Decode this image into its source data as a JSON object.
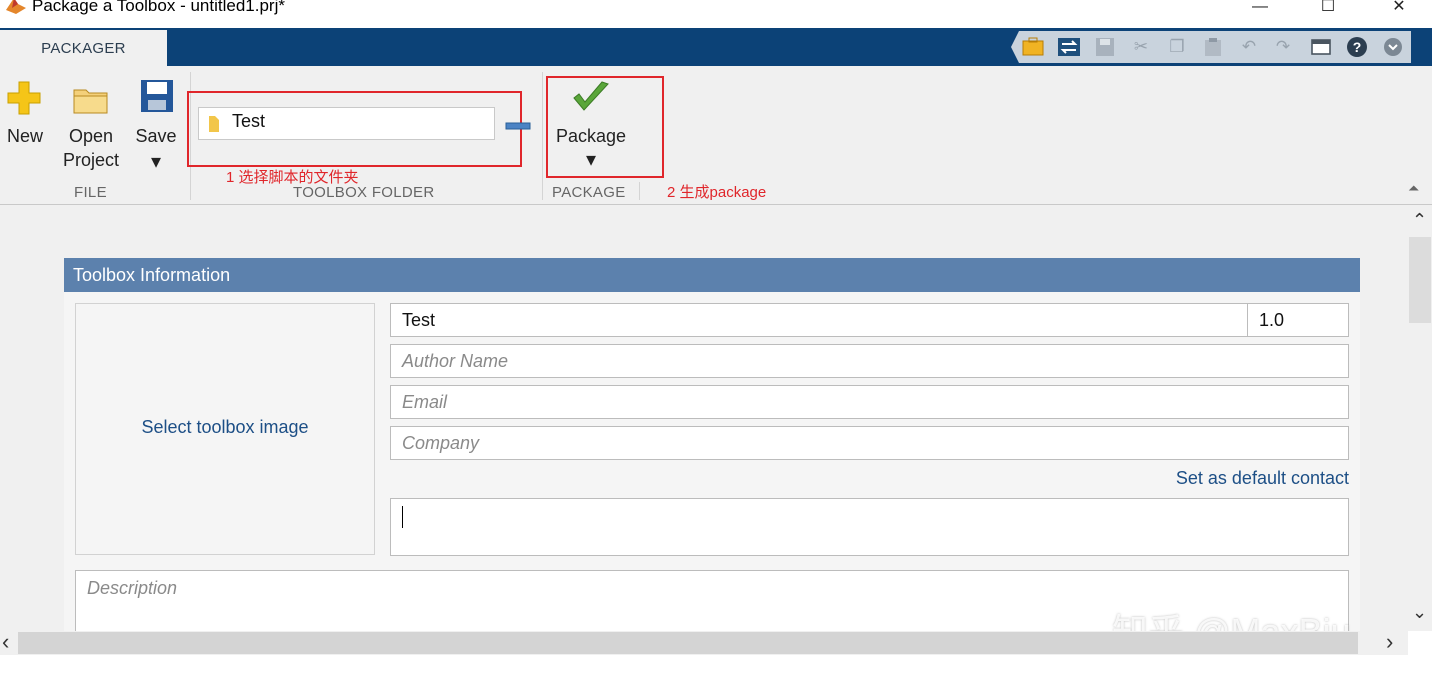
{
  "window": {
    "title": "Package a Toolbox - untitled1.prj*",
    "minimize_glyph": "—",
    "maximize_glyph": "☐",
    "close_glyph": "✕"
  },
  "tabs": [
    {
      "label": "PACKAGER",
      "active": true
    }
  ],
  "quick_access": {
    "icons": [
      "toolbox-icon",
      "toggle-layout-icon",
      "save-icon",
      "cut-icon",
      "copy-icon",
      "paste-icon",
      "undo-icon",
      "redo-icon",
      "window-icon",
      "help-icon",
      "expand-icon"
    ]
  },
  "ribbon": {
    "file": {
      "section_label": "FILE",
      "new_label": "New",
      "open_label_1": "Open",
      "open_label_2": "Project",
      "save_label": "Save",
      "dropdown_glyph": "▾"
    },
    "toolbox_folder": {
      "section_label": "TOOLBOX FOLDER",
      "folder_value": "Test"
    },
    "package": {
      "section_label": "PACKAGE",
      "button_label": "Package",
      "dropdown_glyph": "▾"
    },
    "collapse_glyph": "⏶"
  },
  "annotations": {
    "step1": "1  选择脚本的文件夹",
    "step2": "2 生成package",
    "accent_color": "#e0262b"
  },
  "toolbox_info": {
    "header": "Toolbox Information",
    "image_link": "Select toolbox image",
    "name_value": "Test",
    "version_value": "1.0",
    "author_placeholder": "Author Name",
    "email_placeholder": "Email",
    "company_placeholder": "Company",
    "default_contact_link": "Set as default contact",
    "summary_value": "",
    "description_placeholder": "Description",
    "header_color": "#5c81ad"
  },
  "scrollbars": {
    "up_glyph": "⌃",
    "down_glyph": "⌄",
    "left_glyph": "‹",
    "right_glyph": "›"
  },
  "watermark": "知乎 @MaxBiu"
}
